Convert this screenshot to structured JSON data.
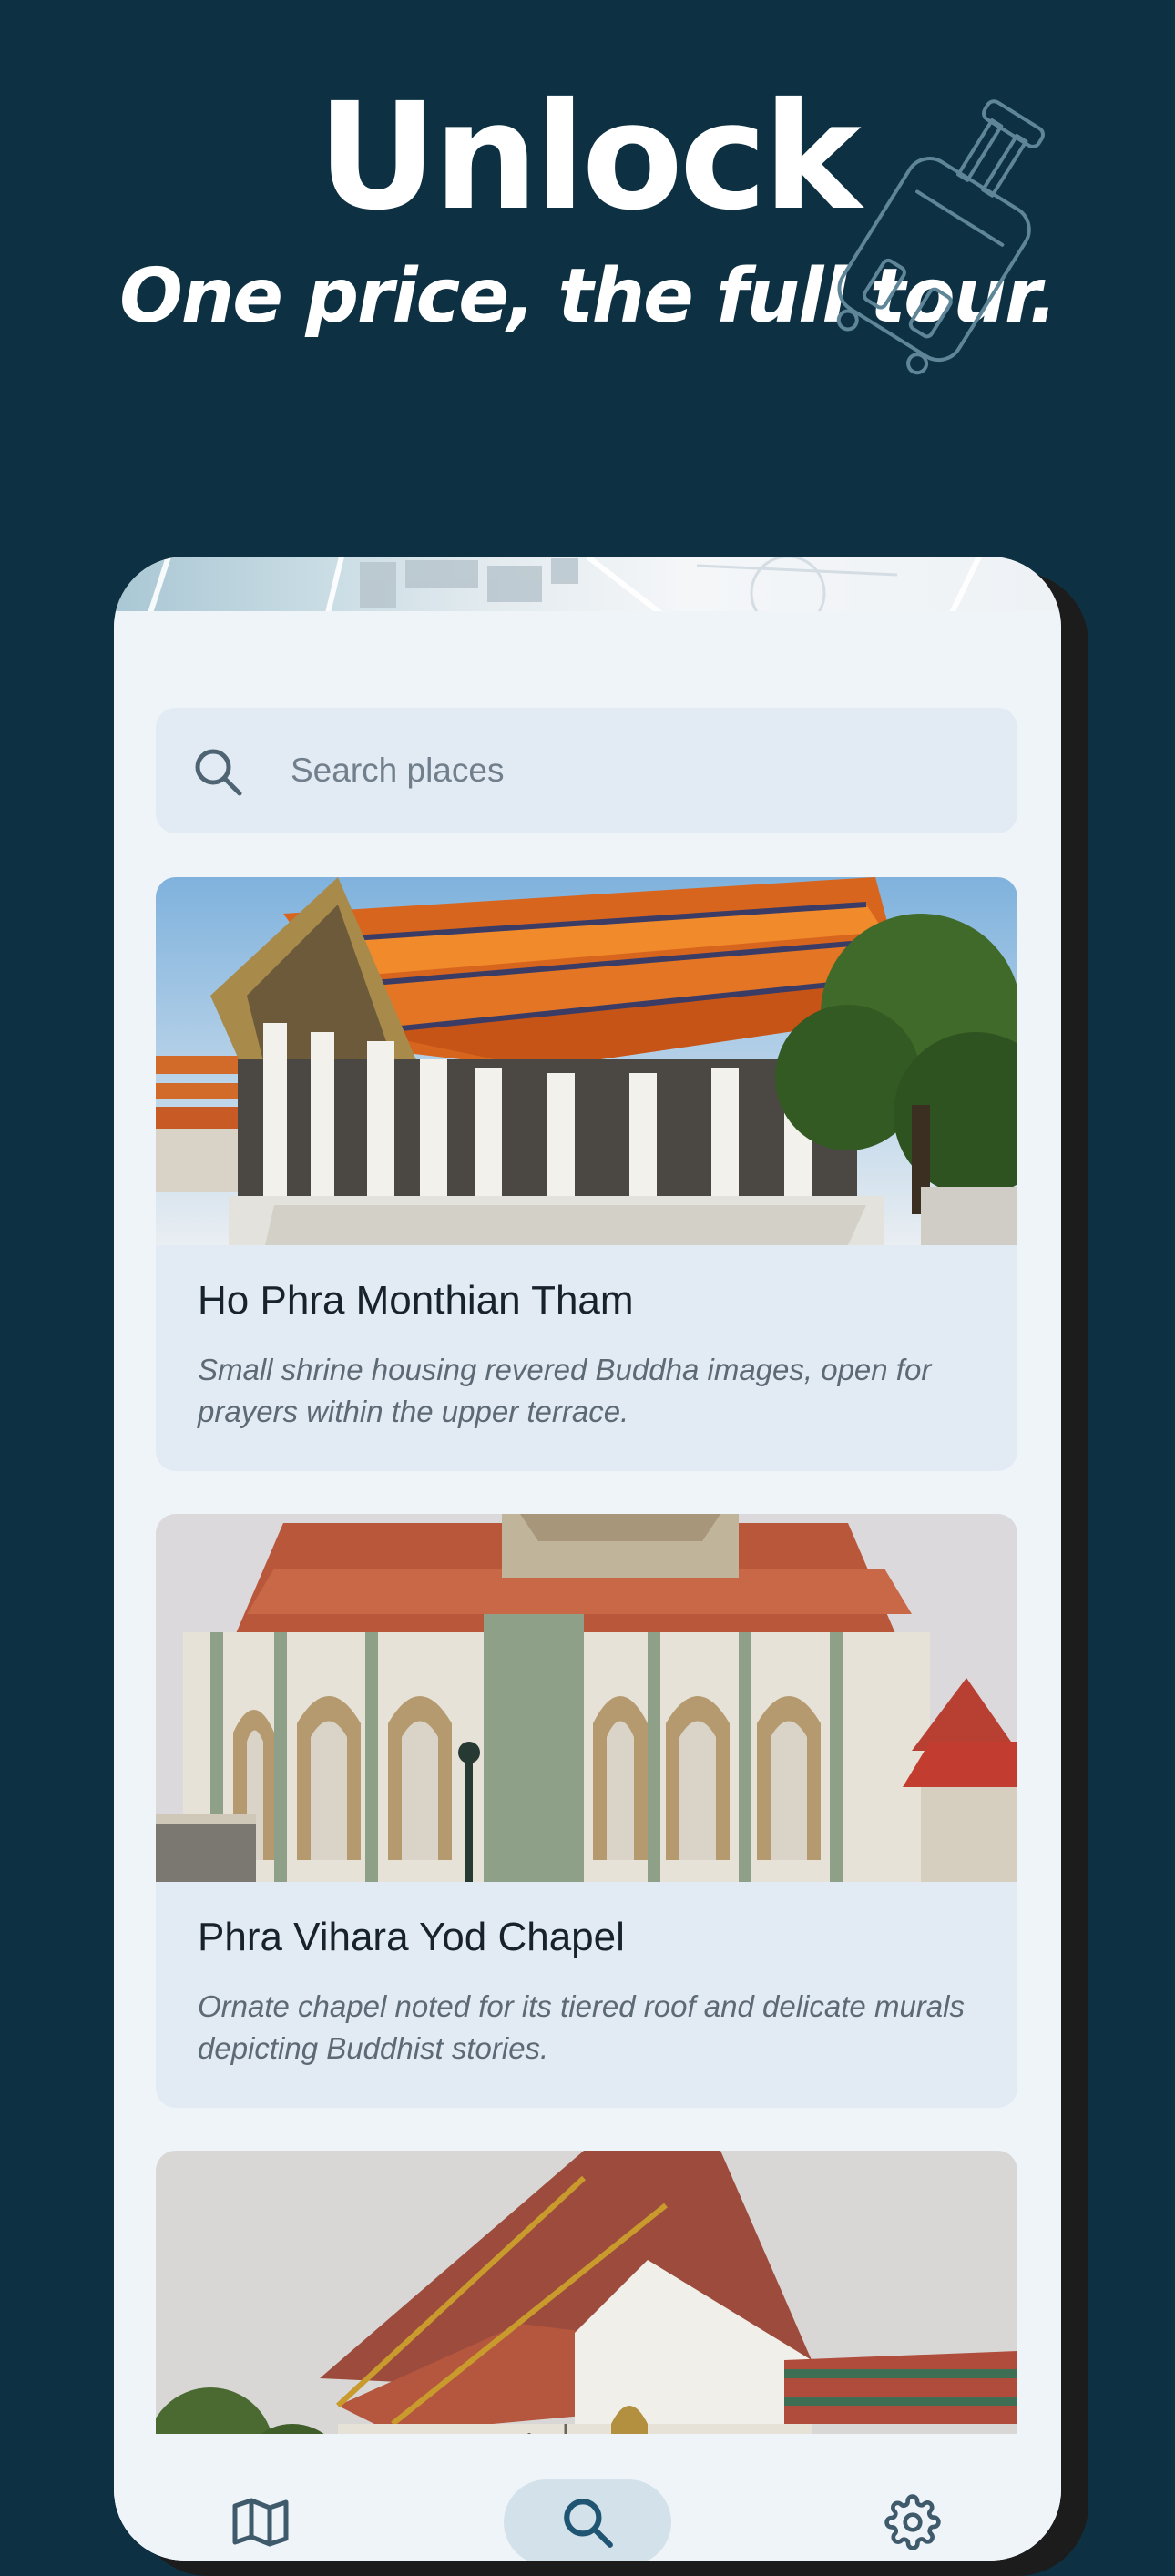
{
  "hero": {
    "title": "Unlock",
    "subtitle": "One price, the full tour."
  },
  "search": {
    "placeholder": "Search places",
    "icon": "search-icon"
  },
  "places": [
    {
      "title": "Ho Phra Monthian Tham",
      "description": "Small shrine housing revered Buddha images, open for prayers within the upper terrace."
    },
    {
      "title": "Phra Vihara Yod Chapel",
      "description": "Ornate chapel noted for its tiered roof and delicate murals depicting Buddhist stories."
    },
    {
      "title": "",
      "description": ""
    }
  ],
  "nav": {
    "items": [
      {
        "icon": "map-icon",
        "active": false
      },
      {
        "icon": "search-icon",
        "active": true
      },
      {
        "icon": "gear-icon",
        "active": false
      }
    ]
  },
  "colors": {
    "background": "#0d3142",
    "card": "#e2eaf3",
    "sheet": "#eff4f9",
    "nav_active": "#d2e1ea",
    "icon": "#3e5a6b"
  }
}
